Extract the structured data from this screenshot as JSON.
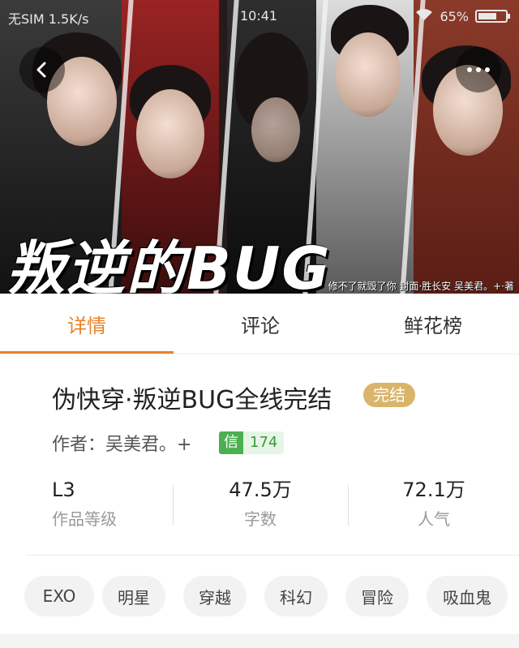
{
  "status_bar": {
    "carrier": "无SIM 1.5K/s",
    "time": "10:41",
    "battery": "65%",
    "battery_level": 0.65
  },
  "banner": {
    "title": "叛逆的BUG",
    "credits": "修不了就毁了你  封面·胜长安  吴美君。+·著"
  },
  "tabs": [
    {
      "label": "详情",
      "active": true
    },
    {
      "label": "评论",
      "active": false
    },
    {
      "label": "鲜花榜",
      "active": false
    }
  ],
  "book": {
    "title": "伪快穿·叛逆BUG全线完结",
    "status": "完结",
    "author": "作者：吴美君。+",
    "xin_label": "信",
    "xin_count": "174"
  },
  "stats": [
    {
      "value": "L3",
      "label": "作品等级"
    },
    {
      "value": "47.5万",
      "label": "字数"
    },
    {
      "value": "72.1万",
      "label": "人气"
    }
  ],
  "tags": [
    "EXO",
    "明星",
    "穿越",
    "科幻",
    "冒险",
    "吸血鬼"
  ],
  "colors": {
    "accent": "#e8832b",
    "finished_badge": "#d9b46b",
    "xin_green": "#4caf50"
  }
}
